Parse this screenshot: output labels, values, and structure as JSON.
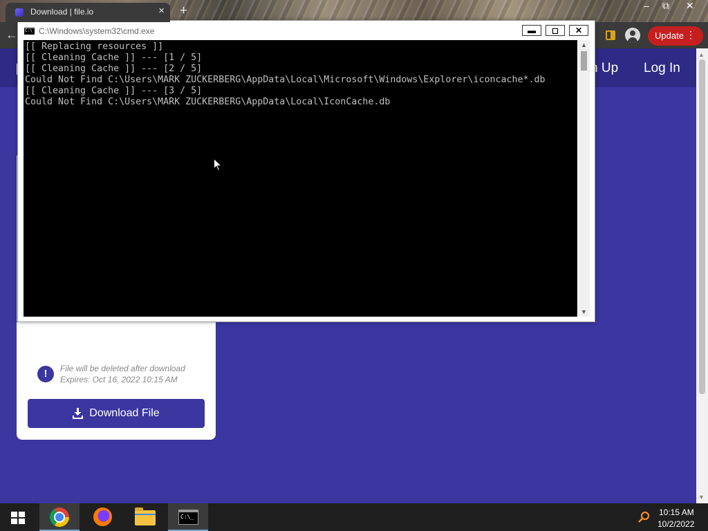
{
  "browser": {
    "tab_title": "Download | file.io",
    "tab_close": "×",
    "new_tab": "+",
    "win_minimize": "–",
    "win_restore": "⧉",
    "win_close": "✕",
    "back": "←",
    "update_label": "Update",
    "menu_dots": "⋮"
  },
  "site": {
    "nav_signup": "n Up",
    "nav_login": "Log In",
    "info_icon": "!",
    "info_line1": "File will be deleted after download",
    "info_line2": "Expires: Oct 16, 2022 10:15 AM",
    "download_label": "Download File"
  },
  "cmd": {
    "title": "C:\\Windows\\system32\\cmd.exe",
    "icon_text": "C:\\",
    "minimize": "▬",
    "maximize": "◻",
    "close": "✕",
    "lines": [
      "[[ Replacing resources ]]",
      "[[ Cleaning Cache ]] --- [1 / 5]",
      "[[ Cleaning Cache ]] --- [2 / 5]",
      "Could Not Find C:\\Users\\MARK ZUCKERBERG\\AppData\\Local\\Microsoft\\Windows\\Explorer\\iconcache*.db",
      "[[ Cleaning Cache ]] --- [3 / 5]",
      "Could Not Find C:\\Users\\MARK ZUCKERBERG\\AppData\\Local\\IconCache.db"
    ],
    "scroll_up": "▲",
    "scroll_down": "▼"
  },
  "taskbar": {
    "cmd_icon_text": "C:\\_",
    "time": "10:15 AM",
    "date": "10/2/2022"
  },
  "colors": {
    "page_bg": "#3b36a0",
    "header_bg": "#2e2a86",
    "update_red": "#c61f1f",
    "console_text": "#c0c0c0"
  }
}
